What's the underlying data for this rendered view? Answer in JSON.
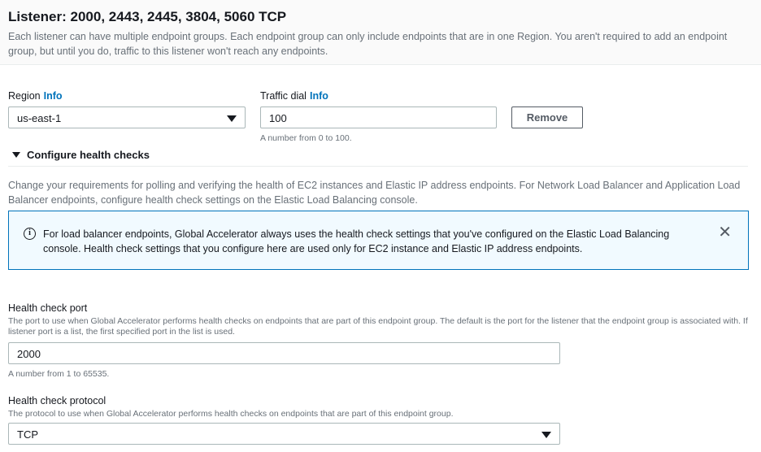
{
  "listener": {
    "title": "Listener: 2000, 2443, 2445, 3804, 5060 TCP",
    "description": "Each listener can have multiple endpoint groups. Each endpoint group can only include endpoints that are in one Region. You aren't required to add an endpoint group, but until you do, traffic to this listener won't reach any endpoints."
  },
  "region": {
    "label": "Region",
    "info": "Info",
    "value": "us-east-1"
  },
  "traffic_dial": {
    "label": "Traffic dial",
    "info": "Info",
    "value": "100",
    "hint": "A number from 0 to 100."
  },
  "remove_button": "Remove",
  "health_checks": {
    "expander_label": "Configure health checks",
    "description": "Change your requirements for polling and verifying the health of EC2 instances and Elastic IP address endpoints. For Network Load Balancer and Application Load Balancer endpoints, configure health check settings on the Elastic Load Balancing console.",
    "alert": "For load balancer endpoints, Global Accelerator always uses the health check settings that you've configured on the Elastic Load Balancing console. Health check settings that you configure here are used only for EC2 instance and Elastic IP address endpoints.",
    "port": {
      "label": "Health check port",
      "description": "The port to use when Global Accelerator performs health checks on endpoints that are part of this endpoint group. The default is the port for the listener that the endpoint group is associated with. If listener port is a list, the first specified port in the list is used.",
      "value": "2000",
      "hint": "A number from 1 to 65535."
    },
    "protocol": {
      "label": "Health check protocol",
      "description": "The protocol to use when Global Accelerator performs health checks on endpoints that are part of this endpoint group.",
      "value": "TCP"
    }
  },
  "colors": {
    "link": "#0073bb",
    "alert_bg": "#f1faff",
    "alert_border": "#0073bb"
  }
}
